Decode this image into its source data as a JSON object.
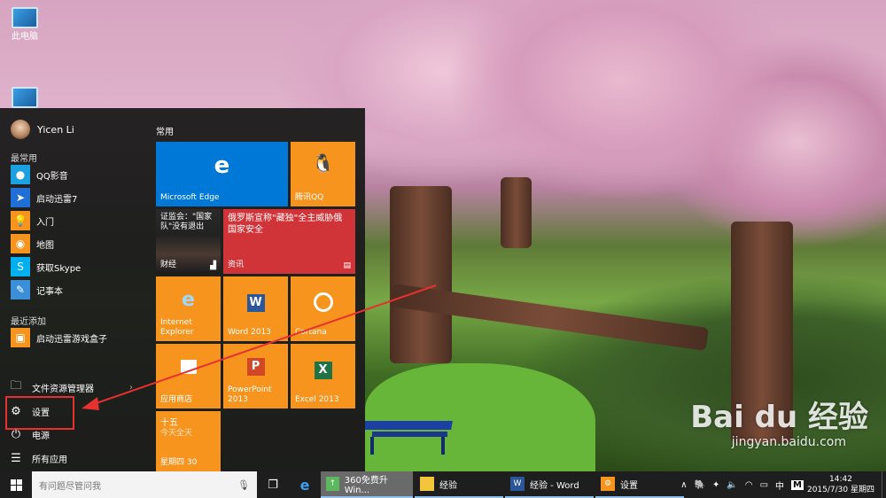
{
  "desktop": {
    "icons": [
      {
        "label": "此电脑",
        "icon": "computer-icon"
      },
      {
        "label": "",
        "icon": "network-icon"
      }
    ],
    "watermark": {
      "logo_text": "Bai du 经验",
      "url": "jingyan.baidu.com"
    }
  },
  "start_menu": {
    "user": {
      "name": "Yicen Li"
    },
    "most_used_label": "最常用",
    "most_used": [
      {
        "label": "QQ影音",
        "icon": "qq-video-icon",
        "color": "#1ba1e2"
      },
      {
        "label": "启动迅雷7",
        "icon": "thunder-icon",
        "color": "#1f6fd6"
      },
      {
        "label": "入门",
        "icon": "lightbulb-icon",
        "color": "#f7941d"
      },
      {
        "label": "地图",
        "icon": "maps-icon",
        "color": "#f7941d"
      },
      {
        "label": "获取Skype",
        "icon": "skype-icon",
        "color": "#00aff0"
      },
      {
        "label": "记事本",
        "icon": "notepad-icon",
        "color": "#3a8fd8"
      }
    ],
    "recently_added_label": "最近添加",
    "recently_added": [
      {
        "label": "启动迅雷游戏盒子",
        "icon": "thunder-games-icon",
        "color": "#f7941d"
      }
    ],
    "bottom": [
      {
        "label": "文件资源管理器",
        "icon": "file-explorer-icon"
      },
      {
        "label": "设置",
        "icon": "settings-gear-icon"
      },
      {
        "label": "电源",
        "icon": "power-icon"
      },
      {
        "label": "所有应用",
        "icon": "all-apps-icon"
      }
    ],
    "tiles_header": "常用",
    "tiles": {
      "edge": {
        "label": "Microsoft Edge",
        "glyph": "e"
      },
      "qq": {
        "label": "腾讯QQ",
        "glyph": "🐧"
      },
      "finance": {
        "headline": "证监会：\"国家队\"没有退出",
        "label": "财经"
      },
      "news": {
        "headline": "俄罗斯宣称\"藏独\"全主威胁俄国家安全",
        "label": "资讯"
      },
      "ie": {
        "label": "Internet Explorer",
        "glyph": "e"
      },
      "word": {
        "label": "Word 2013",
        "glyph": "W"
      },
      "cortana": {
        "label": "Cortana",
        "glyph": "○"
      },
      "store": {
        "label": "应用商店",
        "glyph": "🛍"
      },
      "powerpoint": {
        "label": "PowerPoint 2013",
        "glyph": "P"
      },
      "excel": {
        "label": "Excel 2013",
        "glyph": "X"
      },
      "calendar": {
        "line1": "十五",
        "line2": "今天全天",
        "day": "星期四 30"
      }
    }
  },
  "taskbar": {
    "search_placeholder": "有问题尽管问我",
    "apps": [
      {
        "label": "360免费升Win...",
        "icon": "upgrade-icon",
        "active": true
      },
      {
        "label": "经验",
        "icon": "folder-icon",
        "active": false
      },
      {
        "label": "经验 - Word",
        "icon": "word-icon",
        "active": false
      },
      {
        "label": "设置",
        "icon": "settings-gear-icon",
        "active": false
      }
    ],
    "tray": {
      "chevron": "∧",
      "ime": "中",
      "ime_mode": "M",
      "time": "14:42",
      "date": "2015/7/30 星期四"
    }
  },
  "colors": {
    "tile_orange": "#f7941d",
    "tile_blue": "#0078d7",
    "tile_red": "#d13438",
    "annotation_red": "#e5312f"
  }
}
